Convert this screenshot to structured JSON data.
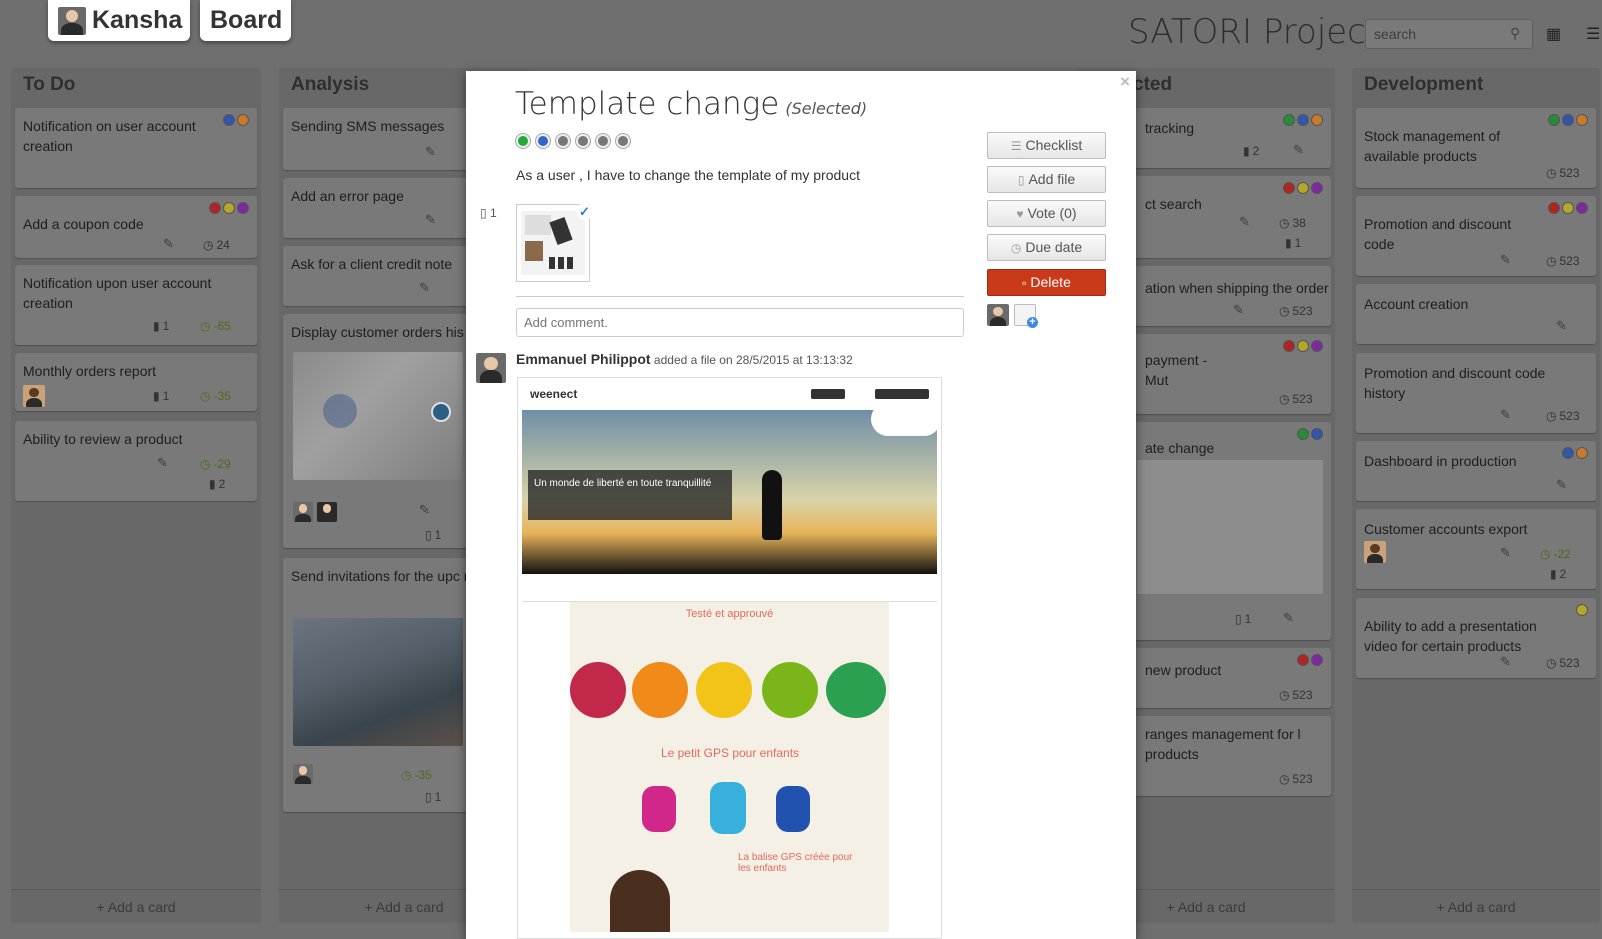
{
  "header": {
    "user_name": "Kansha",
    "board_label": "Board",
    "project_title": "SATORI Project",
    "search_placeholder": "search"
  },
  "lists": [
    {
      "title": "To Do",
      "add_card": "+ Add a card",
      "cards": [
        {
          "text": "Notification on user account creation",
          "dots": [
            "#3355aa",
            "#c87a2a"
          ]
        },
        {
          "text": "Add a coupon code",
          "dots": [
            "#b02424",
            "#b6a72a",
            "#7d2aa0"
          ],
          "due": "24"
        },
        {
          "text": "Notification upon user account creation",
          "comments": "1",
          "due": "-65"
        },
        {
          "text": "Monthly orders report",
          "comments": "1",
          "due": "-35"
        },
        {
          "text": "Ability to review a product",
          "due": "-29",
          "comments": "2"
        }
      ]
    },
    {
      "title": "Analysis",
      "add_card": "+ Add a card",
      "cards": [
        {
          "text": "Sending SMS messages"
        },
        {
          "text": "Add an error page"
        },
        {
          "text": "Ask for a client credit note"
        },
        {
          "text": "Display customer orders his",
          "files": "1"
        },
        {
          "text": "Send invitations for the upc meeting",
          "due": "-35",
          "files": "1"
        }
      ]
    },
    {
      "title": "cted",
      "add_card": "+ Add a card",
      "cards": [
        {
          "text": "tracking",
          "comments": "2"
        },
        {
          "text": "ct search",
          "due": "38",
          "comments": "1"
        },
        {
          "text": "ation when shipping the order",
          "due": "523"
        },
        {
          "text": "payment - Mut",
          "due": "523"
        },
        {
          "text": "ate change",
          "files": "1"
        },
        {
          "text": "new product",
          "due": "523"
        },
        {
          "text": "ranges management for l products",
          "due": "523"
        }
      ]
    },
    {
      "title": "Development",
      "add_card": "+ Add a card",
      "cards": [
        {
          "text": "Stock management of available products",
          "due": "523"
        },
        {
          "text": "Promotion and discount code",
          "due": "523"
        },
        {
          "text": "Account creation"
        },
        {
          "text": "Promotion and discount code history",
          "due": "523"
        },
        {
          "text": "Dashboard in production"
        },
        {
          "text": "Customer accounts export",
          "due": "-22",
          "comments": "2"
        },
        {
          "text": "Ability to add a presentation video for certain products",
          "due": "523"
        }
      ]
    }
  ],
  "modal": {
    "title": "Template change",
    "status": "(Selected)",
    "colors": [
      "#22aa33",
      "#3366cc",
      "#777777",
      "#777777",
      "#777777",
      "#777777"
    ],
    "description": "As a user , I have to change the template of my product",
    "attachments_count": "1",
    "comment_placeholder": "Add comment.",
    "activity_author": "Emmanuel Philippot",
    "activity_text": "added a file on 28/5/2015 at 13:13:32",
    "buttons": {
      "checklist": "Checklist",
      "add_file": "Add file",
      "vote": "Vote (0)",
      "due_date": "Due date",
      "delete": "Delete"
    },
    "preview": {
      "logo": "weenect",
      "tagline": "Un monde de liberté en toute tranquillité",
      "tested": "Testé et approuvé",
      "product_heading": "Le petit GPS pour enfants",
      "subheading": "La balise GPS créée pour les enfants"
    }
  }
}
